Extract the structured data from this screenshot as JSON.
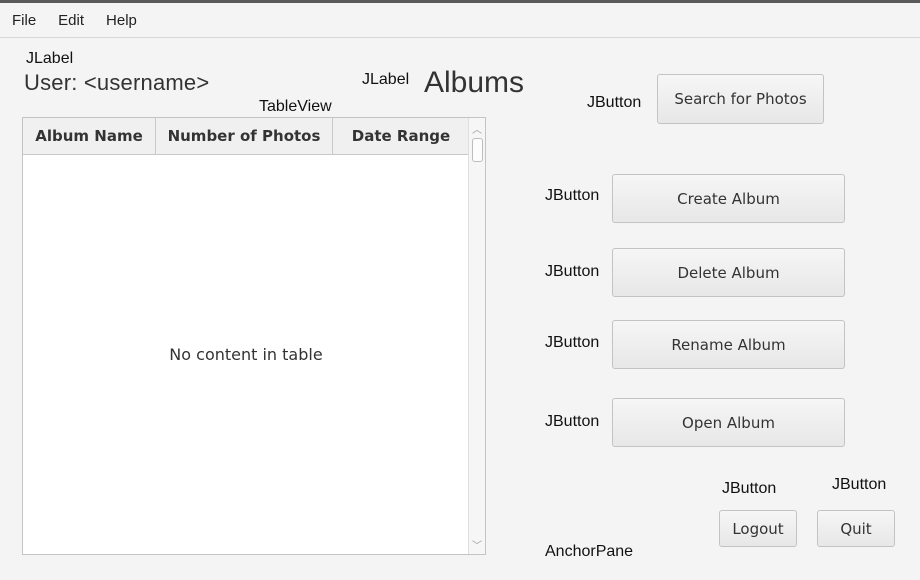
{
  "menu": {
    "items": [
      "File",
      "Edit",
      "Help"
    ]
  },
  "annotations": {
    "jlabel_user": "JLabel",
    "jlabel_albums": "JLabel",
    "tableview": "TableView",
    "jbutton": "JButton",
    "anchorpane": "AnchorPane"
  },
  "header": {
    "user_label": "User: <username>",
    "albums_title": "Albums"
  },
  "table": {
    "columns": [
      "Album Name",
      "Number of Photos",
      "Date Range"
    ],
    "empty_text": "No content in table"
  },
  "buttons": {
    "search": "Search for Photos",
    "create": "Create Album",
    "delete": "Delete Album",
    "rename": "Rename Album",
    "open": "Open Album",
    "logout": "Logout",
    "quit": "Quit"
  }
}
